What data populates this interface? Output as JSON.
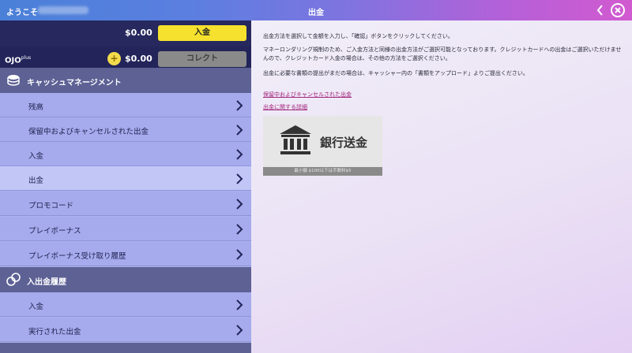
{
  "header": {
    "welcome": "ようこそ",
    "title": "出金",
    "back_icon": "chevron-left-icon",
    "close_icon": "close-circle-icon"
  },
  "balance": {
    "cash_amount": "$0.00",
    "deposit_button": "入金",
    "logo": "OJO",
    "logo_suffix": "plus",
    "bonus_amount": "$0.00",
    "collect_button": "コレクト"
  },
  "sidebar": {
    "cash_section": "キャッシュマネージメント",
    "cash_items": [
      {
        "label": "残高"
      },
      {
        "label": "保留中およびキャンセルされた出金"
      },
      {
        "label": "入金"
      },
      {
        "label": "出金"
      },
      {
        "label": "プロモコード"
      },
      {
        "label": "プレイボーナス"
      },
      {
        "label": "プレイボーナス受け取り履歴"
      }
    ],
    "history_section": "入出金履歴",
    "history_items": [
      {
        "label": "入金"
      },
      {
        "label": "実行された出金"
      }
    ]
  },
  "content": {
    "instruction": "出金方法を選択して金額を入力し、「確認」ボタンをクリックしてください。",
    "aml_notice": "マネーロンダリング規制のため、ご入金方法と同様の出金方法がご選択可能となっております。クレジットカードへの出金はご選択いただけませんので、クレジットカード入金の場合は、その他の方法をご選択ください。",
    "docs_notice": "出金に必要な書類の提出がまだの場合は、キャッシャー内の「書類をアップロード」よりご提出ください。",
    "link_pending": "保留中およびキャンセルされた出金",
    "link_details": "出金に関する詳細",
    "bank_option": {
      "label": "銀行送金",
      "footer": "最小額 $100以下は手数料$5",
      "icon": "bank-building-icon"
    }
  },
  "colors": {
    "accent_yellow": "#f5e12e",
    "link": "#a0207a",
    "sidebar_dark": "#26285e",
    "section_header": "#5d6194",
    "menu_bg": "#a5abec",
    "menu_active": "#c2c6f7"
  }
}
